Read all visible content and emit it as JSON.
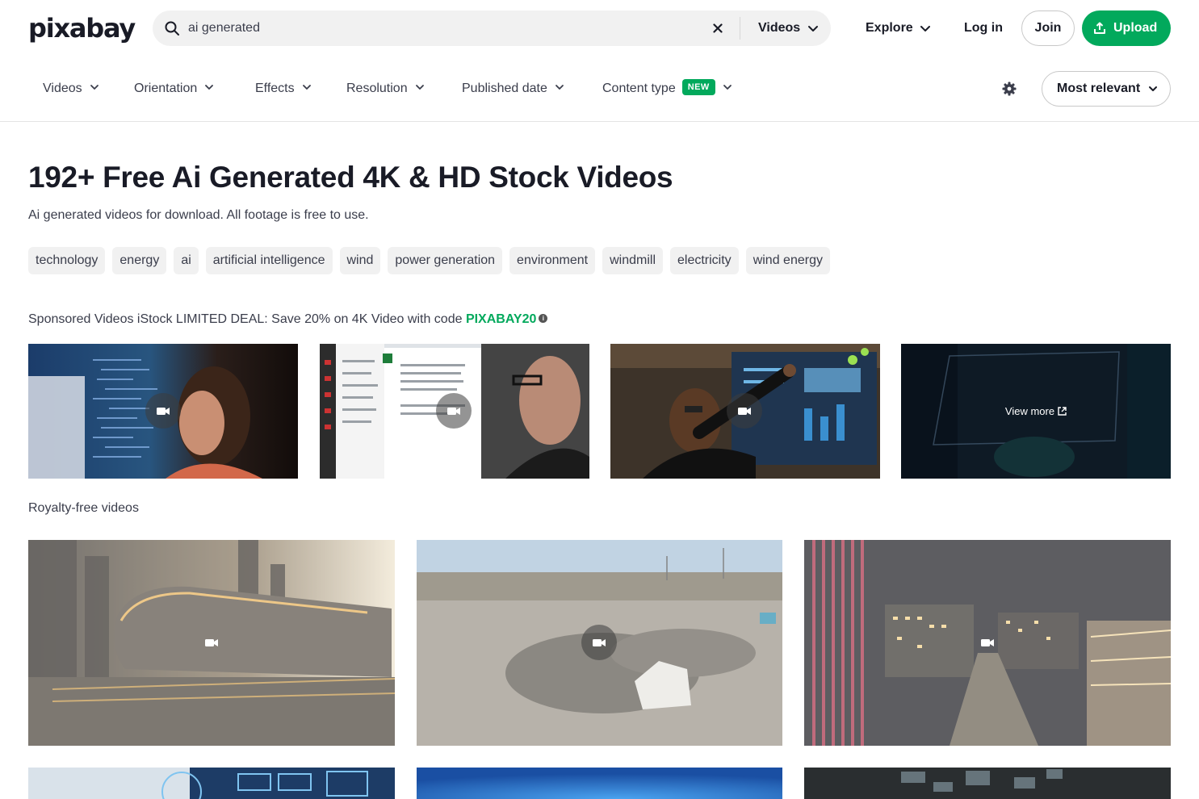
{
  "header": {
    "logo": "pixabay",
    "search_value": "ai generated",
    "search_type": "Videos",
    "explore": "Explore",
    "login": "Log in",
    "join": "Join",
    "upload": "Upload"
  },
  "filters": {
    "items": [
      "Videos",
      "Orientation",
      "Effects",
      "Resolution",
      "Published date",
      "Content type"
    ],
    "new_badge": "NEW",
    "sort": "Most relevant"
  },
  "page": {
    "title": "192+ Free Ai Generated 4K & HD Stock Videos",
    "subtitle": "Ai generated videos for download. All footage is free to use.",
    "tags": [
      "technology",
      "energy",
      "ai",
      "artificial intelligence",
      "wind",
      "power generation",
      "environment",
      "windmill",
      "electricity",
      "wind energy"
    ]
  },
  "sponsored": {
    "prefix": "Sponsored Videos iStock LIMITED DEAL: Save 20% on 4K Video with code ",
    "code": "PIXABAY20",
    "info_icon": "info-icon",
    "view_more": "View more"
  },
  "royalty": {
    "label": "Royalty-free videos"
  },
  "icons": {
    "search": "search-icon",
    "clear": "close-icon",
    "chevron": "chevron-down-icon",
    "upload": "upload-icon",
    "settings": "gear-icon",
    "video": "video-camera-icon",
    "external": "external-link-icon"
  },
  "colors": {
    "brand_green": "#02a95c",
    "text_dark": "#191b26",
    "chip_bg": "#f1f1f1"
  }
}
